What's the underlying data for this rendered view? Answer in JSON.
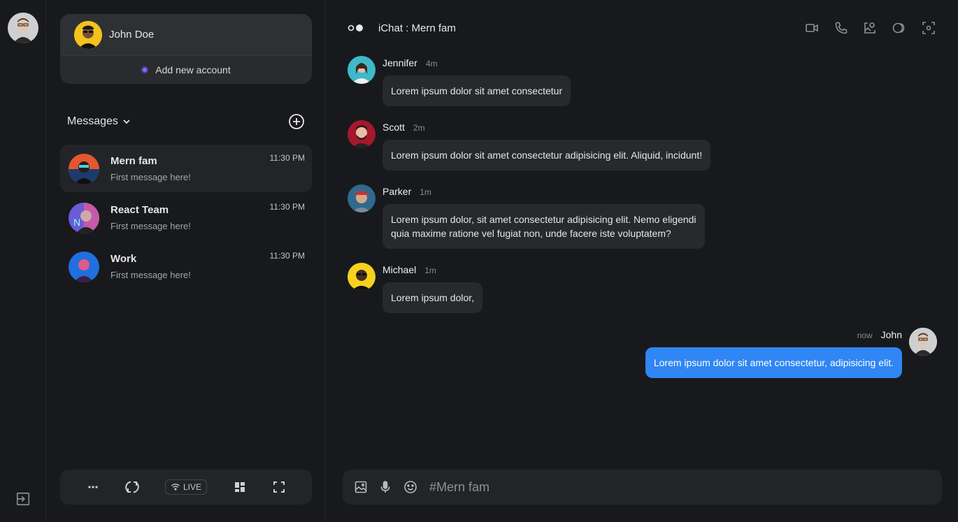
{
  "rail": {
    "avatar_icon": "user-avatar-icon",
    "logout_icon": "logout-icon"
  },
  "account": {
    "name": "John Doe",
    "add_label": "Add new account"
  },
  "messages_header": {
    "title": "Messages"
  },
  "conversations": [
    {
      "name": "Mern fam",
      "preview": "First message here!",
      "time": "11:30 PM",
      "active": true
    },
    {
      "name": "React Team",
      "preview": "First message here!",
      "time": "11:30 PM",
      "active": false
    },
    {
      "name": "Work",
      "preview": "First message here!",
      "time": "11:30 PM",
      "active": false
    }
  ],
  "toolbar": {
    "live_label": "LIVE"
  },
  "chat": {
    "title": "iChat : Mern fam",
    "messages": [
      {
        "sender": "Jennifer",
        "ago": "4m",
        "text": "Lorem ipsum dolor sit amet consectetur"
      },
      {
        "sender": "Scott",
        "ago": "2m",
        "text": "Lorem ipsum dolor sit amet consectetur adipisicing elit. Aliquid, incidunt!"
      },
      {
        "sender": "Parker",
        "ago": "1m",
        "text_line1": "Lorem ipsum dolor, sit amet consectetur adipisicing elit. Nemo eligendi",
        "text_line2": "quia maxime ratione vel fugiat non, unde facere iste voluptatem?"
      },
      {
        "sender": "Michael",
        "ago": "1m",
        "text": "Lorem ipsum dolor,"
      }
    ],
    "own": {
      "sender": "John",
      "ago": "now",
      "text": "Lorem ipsum dolor sit amet consectetur, adipisicing elit."
    }
  },
  "composer": {
    "placeholder": "#Mern fam"
  },
  "colors": {
    "background": "#18191c",
    "panel": "#232428",
    "bubble": "#28292d",
    "accent_blue": "#2f86f4",
    "accent_purple": "#8a6cff"
  }
}
